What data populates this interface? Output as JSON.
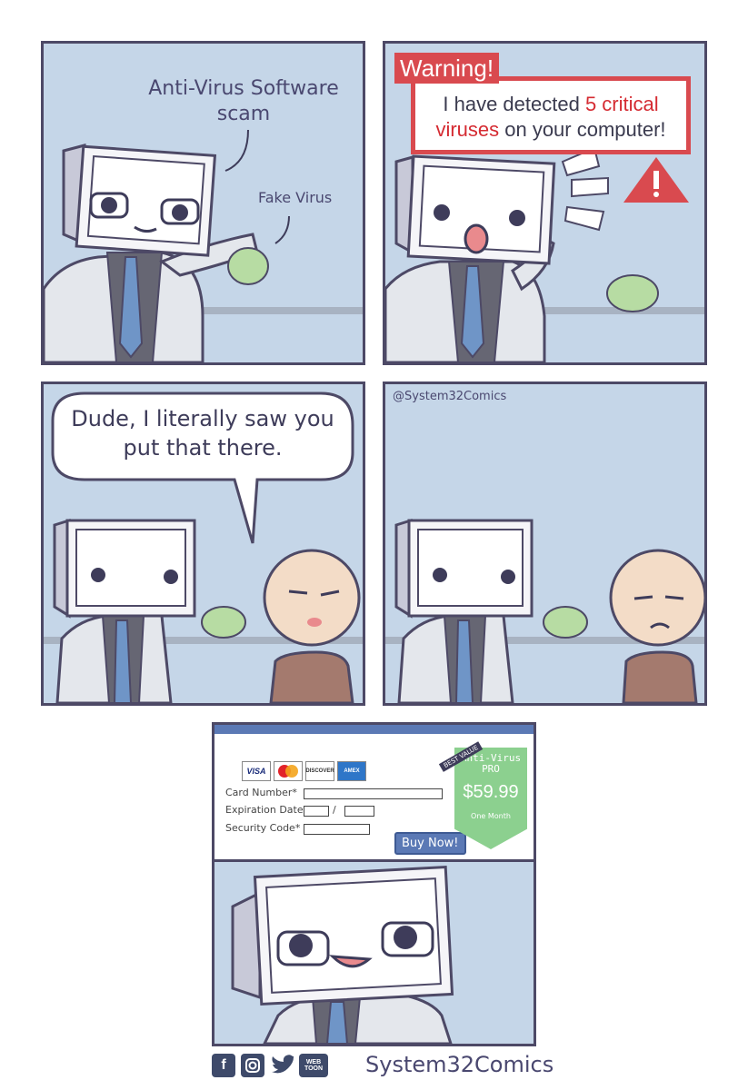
{
  "panel1": {
    "caption": "Anti-Virus Software scam",
    "label": "Fake Virus"
  },
  "panel2": {
    "warning_title": "Warning!",
    "warning_line1_pre": "I have detected ",
    "warning_highlight1": "5 critical",
    "warning_highlight2": "viruses",
    "warning_line2_post": " on your computer!"
  },
  "panel3": {
    "speech": "Dude, I literally saw you put that there."
  },
  "panel4": {
    "credit": "@System32Comics"
  },
  "panel5": {
    "card_logos": [
      "VISA",
      "MasterCard",
      "DISCOVER",
      "AMERICAN EXPRESS"
    ],
    "fields": {
      "card_number": "Card Number*",
      "expiration": "Expiration Date*",
      "security": "Security Code*"
    },
    "expiration_separator": "/",
    "buy_button": "Buy Now!",
    "badge": "BEST VALUE",
    "product_line1": "Anti-Virus",
    "product_line2": "PRO",
    "price": "$59.99",
    "term": "One Month"
  },
  "footer": {
    "name": "System32Comics",
    "social": [
      "facebook-icon",
      "instagram-icon",
      "twitter-icon",
      "webtoon-icon"
    ],
    "webtoon_label": "WEB TOON"
  },
  "colors": {
    "panel_bg": "#c5d6e8",
    "border": "#4d4966",
    "warning_red": "#d94a4f",
    "price_green": "#8cd08f",
    "button_blue": "#5b79b5"
  }
}
